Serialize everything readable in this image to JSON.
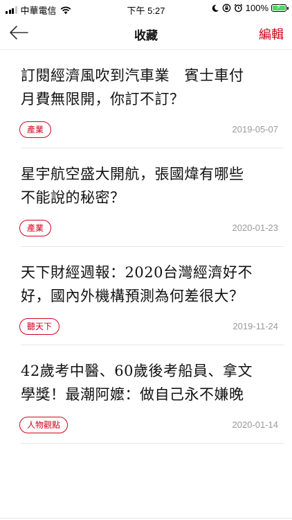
{
  "status_bar": {
    "carrier": "中華電信",
    "time": "下午 5:27",
    "battery_text": "100%",
    "battery_level": 1.0,
    "battery_color": "#4cd964"
  },
  "nav": {
    "title": "收藏",
    "edit_label": "編輯",
    "back_icon": "arrow-left-icon",
    "accent_color": "#d0021b"
  },
  "articles": [
    {
      "title_line1": "訂閱經濟風吹到汽車業　賓士車付",
      "title_line2": "月費無限開，你訂不訂？",
      "tag": "產業",
      "date": "2019-05-07"
    },
    {
      "title_line1": "星宇航空盛大開航，張國煒有哪些",
      "title_line2": "不能說的秘密？",
      "tag": "產業",
      "date": "2020-01-23"
    },
    {
      "title_line1": "天下財經週報：2020台灣經濟好不",
      "title_line2": "好，國內外機構預測為何差很大？",
      "tag": "聽天下",
      "date": "2019-11-24"
    },
    {
      "title_line1": "42歲考中醫、60歲後考船員、拿文",
      "title_line2": "學獎！最潮阿嬤：做自己永不嫌晚",
      "tag": "人物觀點",
      "date": "2020-01-14"
    }
  ]
}
